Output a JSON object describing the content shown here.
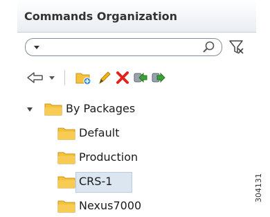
{
  "panel": {
    "title": "Commands Organization"
  },
  "search": {
    "value": "",
    "placeholder": ""
  },
  "toolbar": {
    "icons": [
      "back-arrow-icon",
      "chevron-down-icon",
      "new-folder-icon",
      "pencil-icon",
      "delete-x-icon",
      "import-icon",
      "export-icon"
    ]
  },
  "tree": {
    "root": {
      "label": "By Packages",
      "expanded": true
    },
    "children": [
      {
        "label": "Default",
        "selected": false
      },
      {
        "label": "Production",
        "selected": false
      },
      {
        "label": "CRS-1",
        "selected": true
      },
      {
        "label": "Nexus7000",
        "selected": false
      }
    ]
  },
  "figure_number": "304131",
  "colors": {
    "folder": "#f6c23e",
    "selection": "#dbe6f1",
    "delete": "#e0241c",
    "import_export": "#3aa135"
  }
}
